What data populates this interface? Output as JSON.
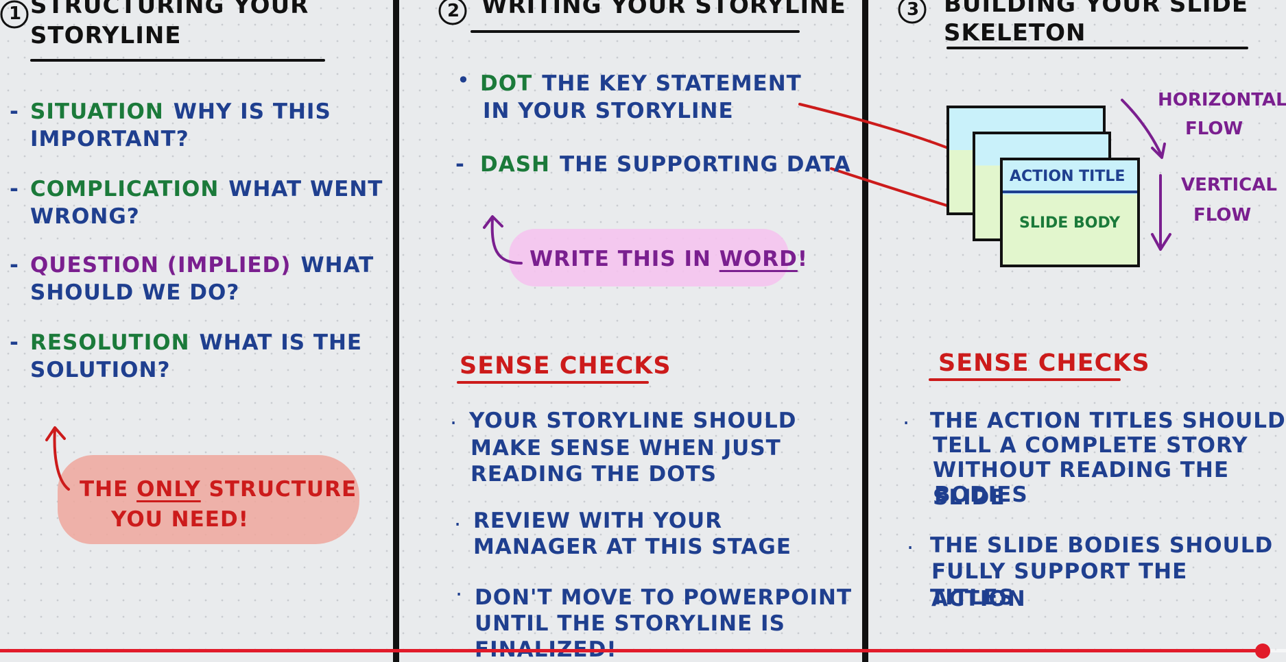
{
  "player": {
    "progress_fraction": 0.982,
    "progress_color": "#e11b2a"
  },
  "colors": {
    "ink": "#111111",
    "navy": "#1f3f8f",
    "green": "#1b7a3a",
    "purple": "#7a1f8f",
    "red": "#cc1b1b"
  },
  "col1": {
    "num": "1",
    "title_l1": "STRUCTURING YOUR",
    "title_l2": "STORYLINE",
    "items": [
      {
        "label": "SITUATION",
        "q1": "WHY IS THIS",
        "q2": "IMPORTANT?"
      },
      {
        "label": "COMPLICATION",
        "q1": "WHAT WENT",
        "q2": "WRONG?"
      },
      {
        "label": "QUESTION (IMPLIED)",
        "q1": "WHAT",
        "q2": "SHOULD WE DO?"
      },
      {
        "label": "RESOLUTION",
        "q1": "WHAT IS THE",
        "q2": "SOLUTION?"
      }
    ],
    "note": {
      "pre": "THE ",
      "emph": "ONLY",
      "post": " STRUCTURE",
      "l2": "YOU NEED!"
    }
  },
  "col2": {
    "num": "2",
    "title": "WRITING YOUR STORYLINE",
    "dot_l1": "DOT THE KEY STATEMENT",
    "dot_l2": "IN YOUR STORYLINE",
    "dash_label": "DASH",
    "dash_rest": "THE SUPPORTING DATA",
    "note": {
      "pre": "WRITE THIS IN ",
      "emph": "WORD",
      "post": "!"
    },
    "sense_title": "SENSE CHECKS",
    "checks": [
      [
        "YOUR STORYLINE SHOULD",
        "MAKE SENSE WHEN JUST",
        "READING THE DOTS"
      ],
      [
        "REVIEW WITH YOUR",
        "MANAGER AT THIS STAGE"
      ],
      [
        "DON'T MOVE TO POWERPOINT",
        "UNTIL THE STORYLINE IS",
        "FINALIZED!"
      ]
    ]
  },
  "col3": {
    "num": "3",
    "title_l1": "BUILDING YOUR SLIDE",
    "title_l2": "SKELETON",
    "slide_action": "ACTION TITLE",
    "slide_body": "SLIDE BODY",
    "horizontal_l1": "HORIZONTAL",
    "horizontal_l2": "FLOW",
    "vertical_l1": "VERTICAL",
    "vertical_l2": "FLOW",
    "sense_title": "SENSE CHECKS",
    "checks": [
      [
        "THE ACTION TITLES SHOULD",
        "TELL A COMPLETE STORY",
        "WITHOUT READING THE SLIDE",
        "BODIES"
      ],
      [
        "THE SLIDE BODIES SHOULD",
        "FULLY SUPPORT THE ACTION",
        "TITLES"
      ]
    ]
  }
}
